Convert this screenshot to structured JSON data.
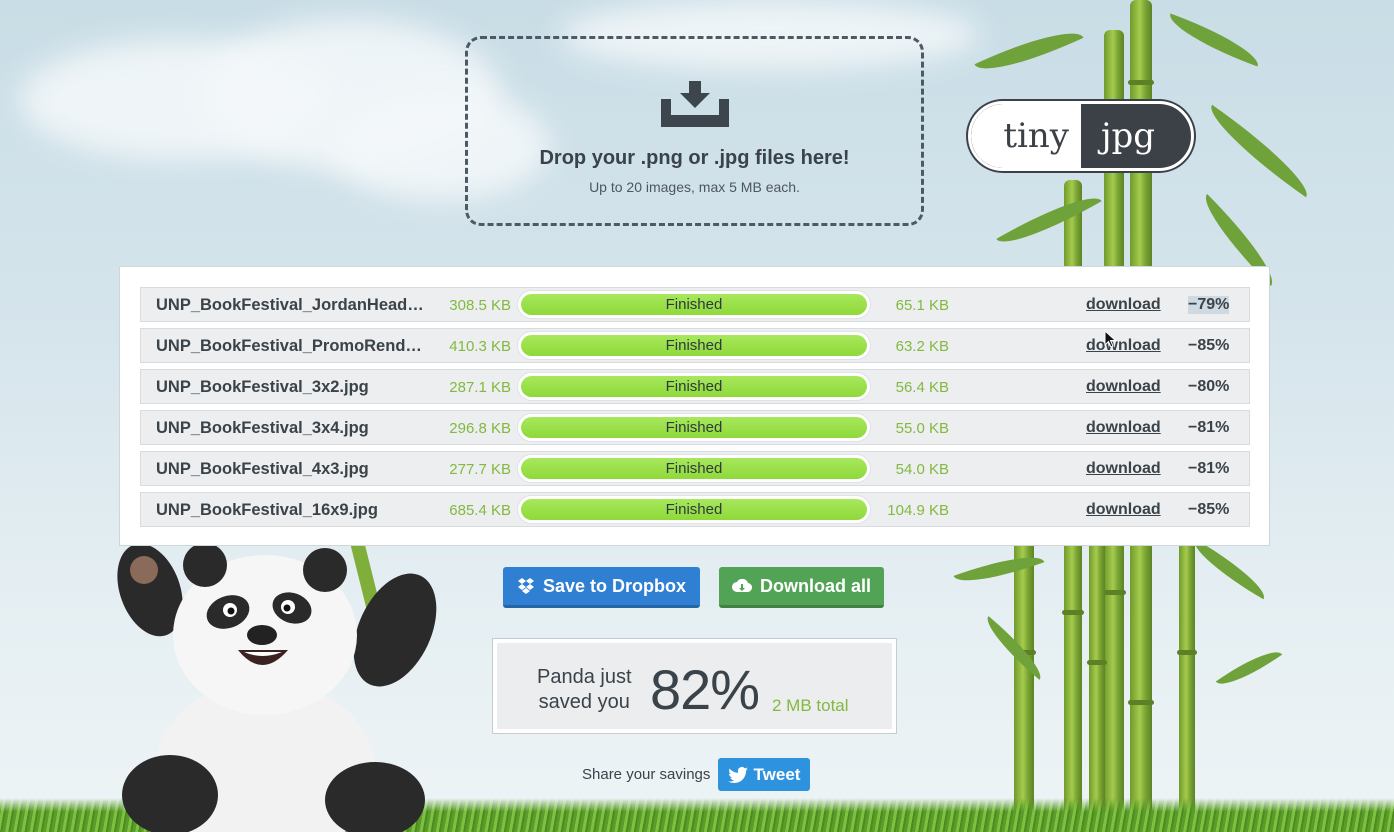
{
  "dropzone": {
    "title": "Drop your .png or .jpg files here!",
    "subtitle": "Up to 20 images, max 5 MB each.",
    "icon": "download-tray-icon"
  },
  "logo": {
    "left": "tiny",
    "right": "jpg"
  },
  "files": [
    {
      "name": "UNP_BookFestival_JordanHead…",
      "original_size": "308.5 KB",
      "status": "Finished",
      "progress": 1.0,
      "new_size": "65.1 KB",
      "action": "download",
      "savings": "−79%"
    },
    {
      "name": "UNP_BookFestival_PromoRend…",
      "original_size": "410.3 KB",
      "status": "Finished",
      "progress": 1.0,
      "new_size": "63.2 KB",
      "action": "download",
      "savings": "−85%"
    },
    {
      "name": "UNP_BookFestival_3x2.jpg",
      "original_size": "287.1 KB",
      "status": "Finished",
      "progress": 1.0,
      "new_size": "56.4 KB",
      "action": "download",
      "savings": "−80%"
    },
    {
      "name": "UNP_BookFestival_3x4.jpg",
      "original_size": "296.8 KB",
      "status": "Finished",
      "progress": 1.0,
      "new_size": "55.0 KB",
      "action": "download",
      "savings": "−81%"
    },
    {
      "name": "UNP_BookFestival_4x3.jpg",
      "original_size": "277.7 KB",
      "status": "Finished",
      "progress": 1.0,
      "new_size": "54.0 KB",
      "action": "download",
      "savings": "−81%"
    },
    {
      "name": "UNP_BookFestival_16x9.jpg",
      "original_size": "685.4 KB",
      "status": "Finished",
      "progress": 1.0,
      "new_size": "104.9 KB",
      "action": "download",
      "savings": "−85%"
    }
  ],
  "actions": {
    "dropbox_label": "Save to Dropbox",
    "download_all_label": "Download all"
  },
  "savings": {
    "label_line1": "Panda just",
    "label_line2": "saved you",
    "percent": "82%",
    "total": "2 MB total"
  },
  "share": {
    "label": "Share your savings",
    "tweet_label": "Tweet"
  },
  "colors": {
    "accent_green": "#83b940",
    "progress_green": "#96dd42",
    "dropbox_blue": "#2f7fd3",
    "download_green": "#52a356",
    "tweet_blue": "#2e93df",
    "text_dark": "#3a434a"
  }
}
